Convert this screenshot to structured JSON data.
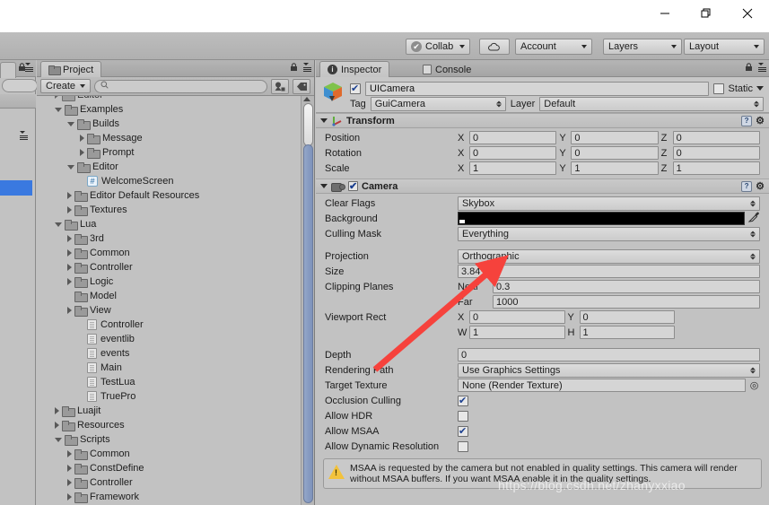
{
  "window": {
    "minimize_label": "—",
    "maximize_label": "❐",
    "close_label": "✕"
  },
  "toolbar": {
    "collab_label": "Collab",
    "collab_check": "✔",
    "cloud_label": "☁",
    "account_label": "Account",
    "layers_label": "Layers",
    "layout_label": "Layout"
  },
  "project_panel": {
    "tab_label": "Project",
    "create_label": "Create",
    "search_placeholder": "",
    "search_value": "",
    "search_icon": "⌕",
    "filter_type_icon": "◢",
    "filter_label_icon": "◈",
    "lock_icon": "ὑ2",
    "tree": [
      {
        "label": "Editor",
        "depth": 1,
        "toggle": "right",
        "icon": "folder",
        "partial": true
      },
      {
        "label": "Examples",
        "depth": 1,
        "toggle": "down",
        "icon": "folder"
      },
      {
        "label": "Builds",
        "depth": 2,
        "toggle": "down",
        "icon": "folder"
      },
      {
        "label": "Message",
        "depth": 3,
        "toggle": "right",
        "icon": "folder"
      },
      {
        "label": "Prompt",
        "depth": 3,
        "toggle": "right",
        "icon": "folder"
      },
      {
        "label": "Editor",
        "depth": 2,
        "toggle": "down",
        "icon": "folder"
      },
      {
        "label": "WelcomeScreen",
        "depth": 3,
        "toggle": "none",
        "icon": "cs"
      },
      {
        "label": "Editor Default Resources",
        "depth": 2,
        "toggle": "right",
        "icon": "folder"
      },
      {
        "label": "Textures",
        "depth": 2,
        "toggle": "right",
        "icon": "folder"
      },
      {
        "label": "Lua",
        "depth": 1,
        "toggle": "down",
        "icon": "folder"
      },
      {
        "label": "3rd",
        "depth": 2,
        "toggle": "right",
        "icon": "folder"
      },
      {
        "label": "Common",
        "depth": 2,
        "toggle": "right",
        "icon": "folder"
      },
      {
        "label": "Controller",
        "depth": 2,
        "toggle": "right",
        "icon": "folder"
      },
      {
        "label": "Logic",
        "depth": 2,
        "toggle": "right",
        "icon": "folder"
      },
      {
        "label": "Model",
        "depth": 2,
        "toggle": "none",
        "icon": "folder"
      },
      {
        "label": "View",
        "depth": 2,
        "toggle": "right",
        "icon": "folder"
      },
      {
        "label": "Controller",
        "depth": 3,
        "toggle": "none",
        "icon": "script"
      },
      {
        "label": "eventlib",
        "depth": 3,
        "toggle": "none",
        "icon": "script"
      },
      {
        "label": "events",
        "depth": 3,
        "toggle": "none",
        "icon": "script"
      },
      {
        "label": "Main",
        "depth": 3,
        "toggle": "none",
        "icon": "script"
      },
      {
        "label": "TestLua",
        "depth": 3,
        "toggle": "none",
        "icon": "script"
      },
      {
        "label": "TruePro",
        "depth": 3,
        "toggle": "none",
        "icon": "script"
      },
      {
        "label": "Luajit",
        "depth": 1,
        "toggle": "right",
        "icon": "folder"
      },
      {
        "label": "Resources",
        "depth": 1,
        "toggle": "right",
        "icon": "folder"
      },
      {
        "label": "Scripts",
        "depth": 1,
        "toggle": "down",
        "icon": "folder"
      },
      {
        "label": "Common",
        "depth": 2,
        "toggle": "right",
        "icon": "folder"
      },
      {
        "label": "ConstDefine",
        "depth": 2,
        "toggle": "right",
        "icon": "folder"
      },
      {
        "label": "Controller",
        "depth": 2,
        "toggle": "right",
        "icon": "folder"
      },
      {
        "label": "Framework",
        "depth": 2,
        "toggle": "right",
        "icon": "folder"
      }
    ]
  },
  "inspector": {
    "tabs": [
      {
        "label": "Inspector",
        "icon": "info-icon",
        "active": true
      },
      {
        "label": "Console",
        "icon": "console-icon",
        "active": false
      }
    ],
    "lock_icon": "ὑ2",
    "game_object": {
      "enabled": true,
      "name": "UICamera",
      "static_label": "Static",
      "static_checked": false,
      "tag_label": "Tag",
      "tag_value": "GuiCamera",
      "layer_label": "Layer",
      "layer_value": "Default"
    },
    "transform": {
      "title": "Transform",
      "expanded": true,
      "enabled_shown": false,
      "rows": [
        {
          "label": "Position",
          "x": "0",
          "y": "0",
          "z": "0"
        },
        {
          "label": "Rotation",
          "x": "0",
          "y": "0",
          "z": "0"
        },
        {
          "label": "Scale",
          "x": "1",
          "y": "1",
          "z": "1"
        }
      ],
      "axis_labels": [
        "X",
        "Y",
        "Z"
      ]
    },
    "camera": {
      "title": "Camera",
      "expanded": true,
      "enabled": true,
      "clear_flags_label": "Clear Flags",
      "clear_flags_value": "Skybox",
      "background_label": "Background",
      "background_color": "#000000",
      "eyedropper_icon": "✒",
      "culling_mask_label": "Culling Mask",
      "culling_mask_value": "Everything",
      "projection_label": "Projection",
      "projection_value": "Orthographic",
      "size_label": "Size",
      "size_value": "3.84",
      "clipping_planes_label": "Clipping Planes",
      "near_label": "Near",
      "near_value": "0.3",
      "far_label": "Far",
      "far_value": "1000",
      "viewport_rect_label": "Viewport Rect",
      "viewport_x_label": "X",
      "viewport_x": "0",
      "viewport_y_label": "Y",
      "viewport_y": "0",
      "viewport_w_label": "W",
      "viewport_w": "1",
      "viewport_h_label": "H",
      "viewport_h": "1",
      "depth_label": "Depth",
      "depth_value": "0",
      "rendering_path_label": "Rendering Path",
      "rendering_path_value": "Use Graphics Settings",
      "target_texture_label": "Target Texture",
      "target_texture_value": "None (Render Texture)",
      "target_texture_picker_icon": "◎",
      "occlusion_culling_label": "Occlusion Culling",
      "occlusion_culling_checked": true,
      "allow_hdr_label": "Allow HDR",
      "allow_hdr_checked": false,
      "allow_msaa_label": "Allow MSAA",
      "allow_msaa_checked": true,
      "allow_dynamic_resolution_label": "Allow Dynamic Resolution",
      "allow_dynamic_resolution_checked": false,
      "warning_text": "MSAA is requested by the camera but not enabled in quality settings. This camera will render without MSAA buffers. If you want MSAA enable it in the quality settings."
    }
  },
  "annotation": {
    "arrow_color": "#f6423c",
    "watermark": "https://blog.csdn.net/zhanyxxiao"
  }
}
